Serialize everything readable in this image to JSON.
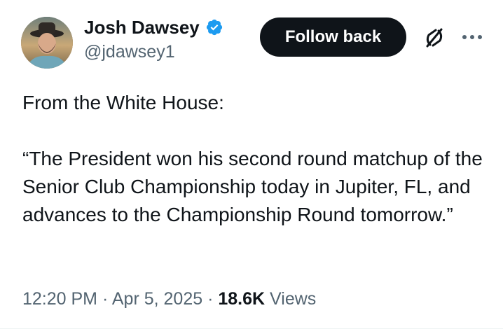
{
  "author": {
    "name": "Josh Dawsey",
    "handle": "@jdawsey1",
    "verified_icon": "verified-badge-icon"
  },
  "actions": {
    "follow_label": "Follow back",
    "grok_icon": "grok-icon",
    "more_icon": "more-options-icon"
  },
  "tweet": {
    "text": "From the White House:\n\n“The President won his second round matchup of the Senior Club Championship today in Jupiter, FL, and advances to the Championship Round tomorrow.”"
  },
  "meta": {
    "time": "12:20 PM",
    "separator": "·",
    "date": "Apr 5, 2025",
    "views_count": "18.6K",
    "views_label": "Views"
  },
  "colors": {
    "text_primary": "#0f1419",
    "text_secondary": "#536471",
    "verified_blue": "#1d9bf0",
    "button_bg": "#0f1419"
  }
}
